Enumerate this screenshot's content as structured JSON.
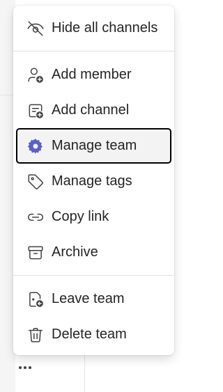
{
  "menu": {
    "hide_all_channels": "Hide all channels",
    "add_member": "Add member",
    "add_channel": "Add channel",
    "manage_team": "Manage team",
    "manage_tags": "Manage tags",
    "copy_link": "Copy link",
    "archive": "Archive",
    "leave_team": "Leave team",
    "delete_team": "Delete team"
  },
  "icons": {
    "hide_all_channels": "eye-off-icon",
    "add_member": "person-add-icon",
    "add_channel": "channel-add-icon",
    "manage_team": "gear-icon",
    "manage_tags": "tag-icon",
    "copy_link": "link-icon",
    "archive": "archive-icon",
    "leave_team": "leave-icon",
    "delete_team": "trash-icon"
  },
  "colors": {
    "accent": "#5b5fc7",
    "text": "#242424",
    "selected_border": "#000000"
  }
}
